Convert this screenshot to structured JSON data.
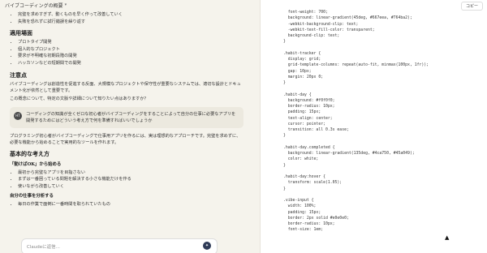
{
  "header": {
    "title": "バイブコーディングの概要"
  },
  "chat": {
    "intro_bullets": [
      "完璧を求めすぎず、動くものを早く作って改善していく",
      "失敗を恐れずに試行錯誤を繰り返す"
    ],
    "sections": [
      {
        "title": "適用場面",
        "bullets": [
          "プロトタイプ開発",
          "個人的なプロジェクト",
          "要求が不明確な初期段階の開発",
          "ハッカソンなどの短期間での開発"
        ]
      }
    ],
    "notes_title": "注意点",
    "notes_text": "バイブコーディングは創造性を促進する反面、大規模なプロジェクトや保守性が重要なシステムでは、適切な設計とドキュメント化が依然として重要です。",
    "followup": "この概念について、特定の文脈や詳細について知りたい点はありますか？",
    "user_badge": "HT",
    "user_message": "コーディングの知識が全くゼロな初心者がバイブコーディングをすることによって自分の仕事に必要なアプリを開発するためにはどういう考え方で何を準備すればいいでしょうか",
    "answer_intro": "プログラミング初心者がバイブコーディングで仕事用アプリを作るには、実は理想的なアプローチです。完璧を求めずに、必要な機能から始めることで実用的なツールを作れます。",
    "answer_title": "基本的な考え方",
    "answer_quote": "「動けばOK」から始める",
    "answer_bullets": [
      "最初から完璧なアプリを目指さない",
      "まずは一番困っている問題を解決する小さな機能だけを作る",
      "使いながら改善していく"
    ],
    "answer_sub": "自分の仕事を分析する",
    "answer_bullet_last": "毎日の作業で面倒に一番時間を取られていたもの"
  },
  "input": {
    "placeholder": "Claudeに返信..."
  },
  "code_panel": {
    "copy_label": "コピー",
    "lines": [
      "  font-weight: 700;",
      "  background: linear-gradient(45deg, #667eea, #764ba2);",
      "  -webkit-background-clip: text;",
      "  -webkit-text-fill-color: transparent;",
      "  background-clip: text;",
      "}",
      "",
      ".habit-tracker {",
      "  display: grid;",
      "  grid-template-columns: repeat(auto-fit, minmax(100px, 1fr));",
      "  gap: 10px;",
      "  margin: 20px 0;",
      "}",
      "",
      ".habit-day {",
      "  background: #f0f0f0;",
      "  border-radius: 10px;",
      "  padding: 15px;",
      "  text-align: center;",
      "  cursor: pointer;",
      "  transition: all 0.3s ease;",
      "}",
      "",
      ".habit-day.completed {",
      "  background: linear-gradient(135deg, #4ca750, #45a049);",
      "  color: white;",
      "}",
      "",
      ".habit-day:hover {",
      "  transform: scale(1.05);",
      "}",
      "",
      ".vibe-input {",
      "  width: 100%;",
      "  padding: 15px;",
      "  border: 2px solid #e0e0e0;",
      "  border-radius: 10px;",
      "  font-size: 1em;"
    ]
  }
}
